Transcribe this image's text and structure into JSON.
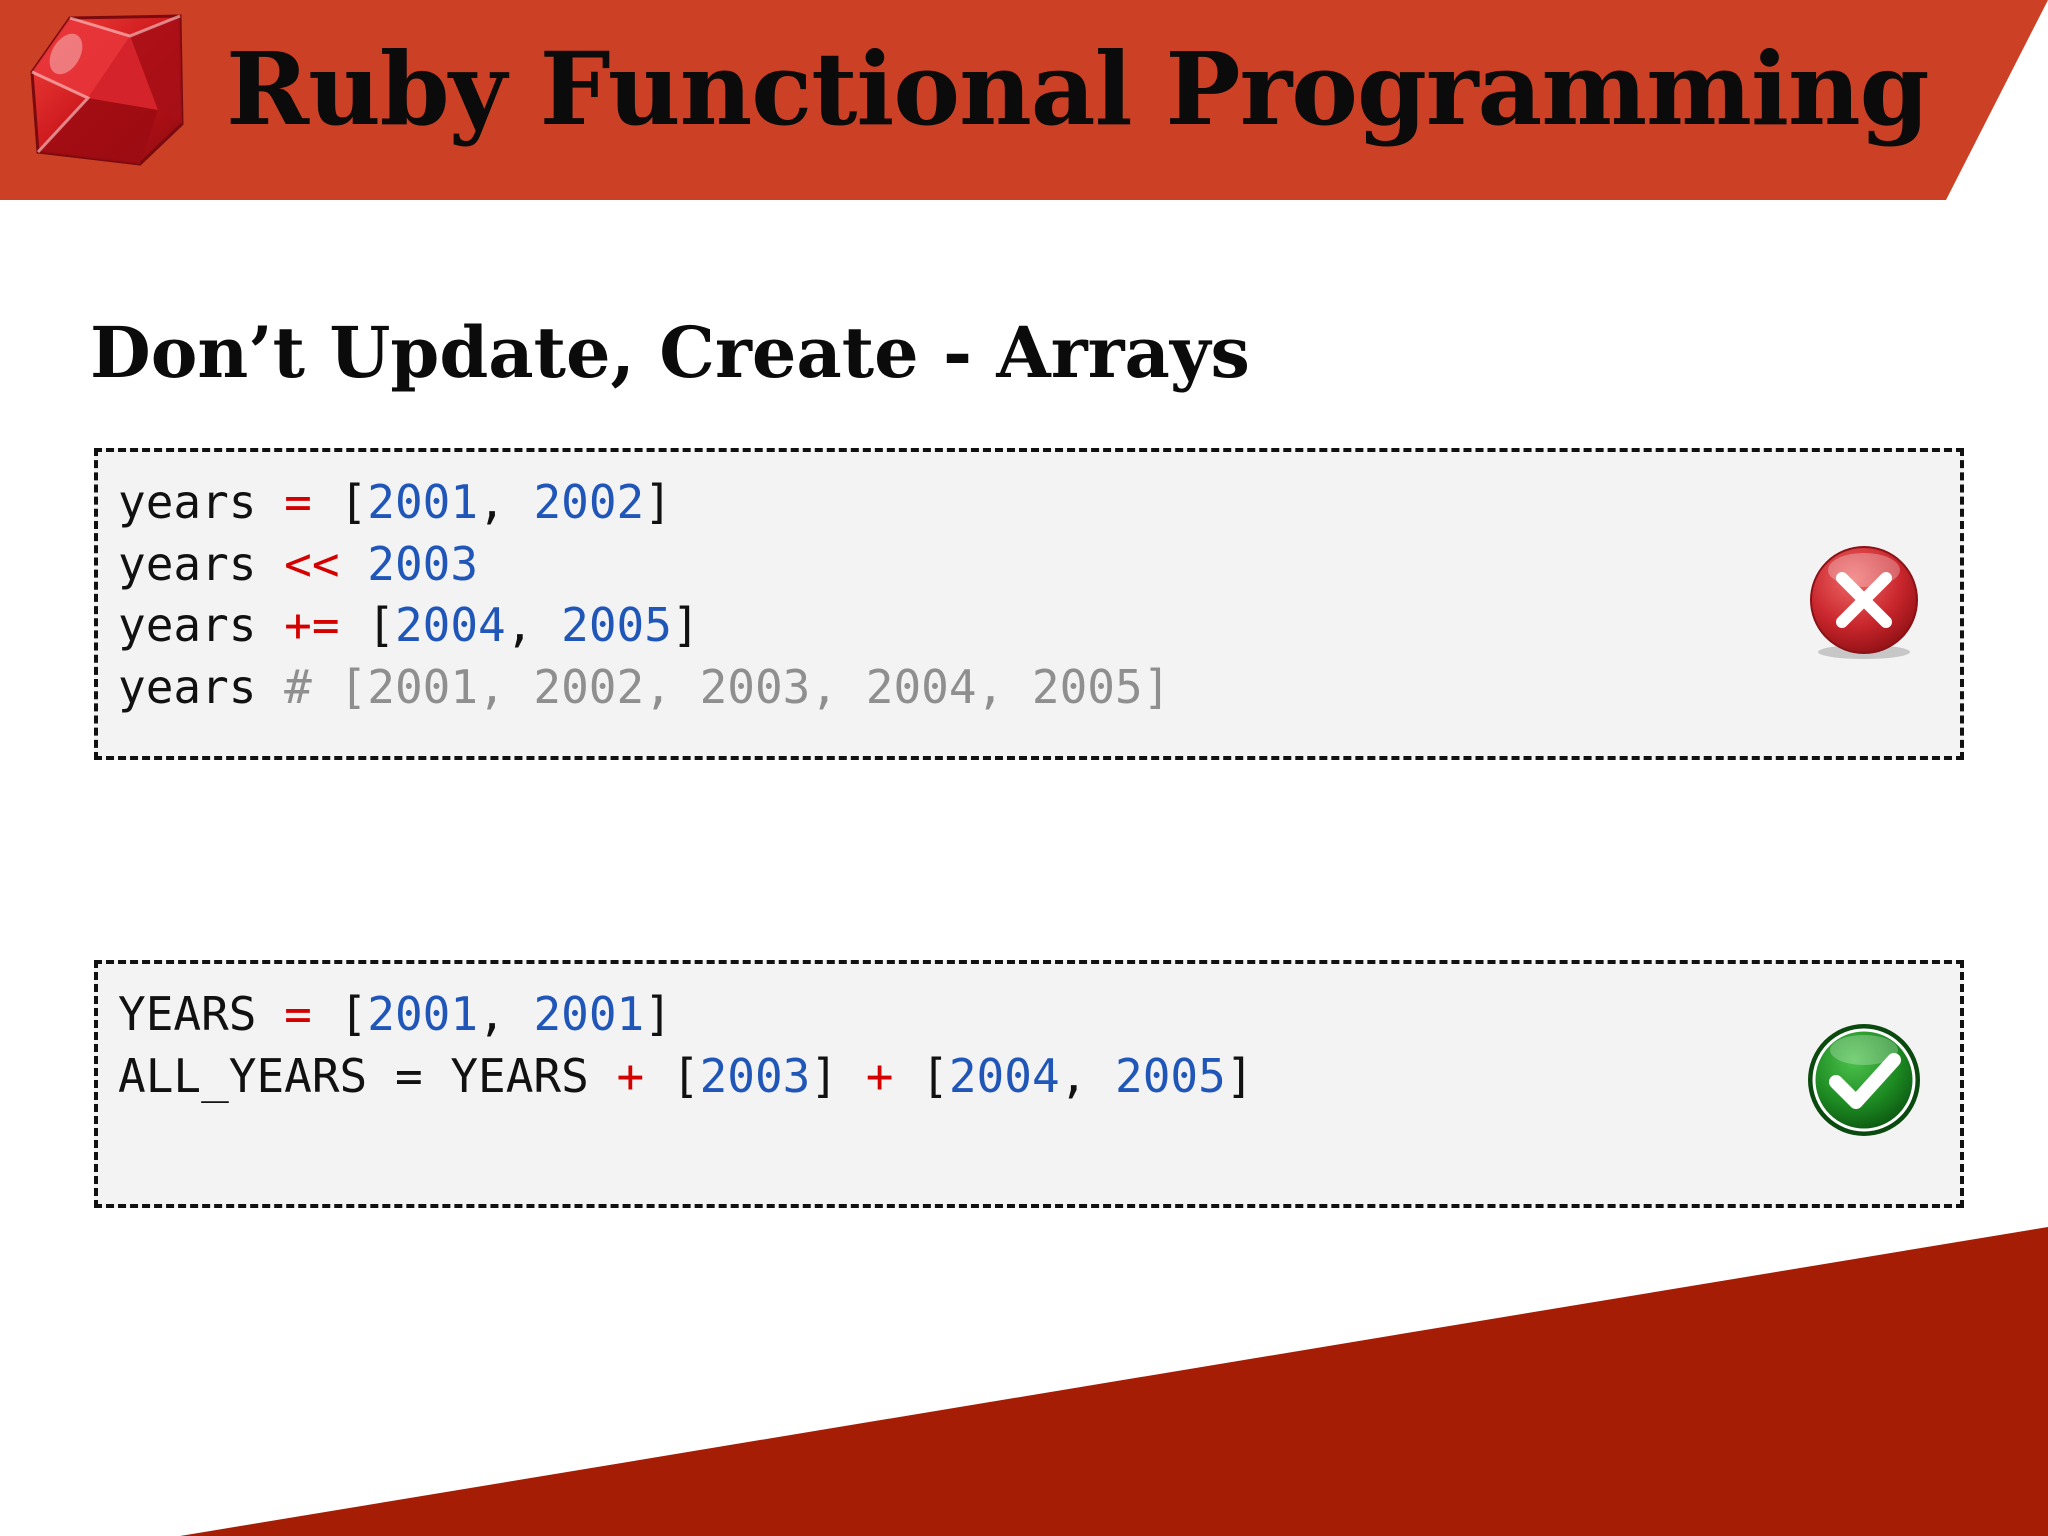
{
  "header": {
    "title": "Ruby Functional Programming",
    "logo_icon": "ruby-gem-icon"
  },
  "slide": {
    "heading": "Don’t Update, Create - Arrays"
  },
  "colors": {
    "header_band": "#cc4126",
    "footer_band": "#a51d05",
    "operator": "#d40000",
    "number": "#1f56b8",
    "comment": "#8f8f8f",
    "code_background": "#f3f3f4"
  },
  "bad_example": {
    "status_icon": "error-x-icon",
    "lines": [
      [
        {
          "t": "years ",
          "c": "plain"
        },
        {
          "t": "=",
          "c": "op"
        },
        {
          "t": " [",
          "c": "plain"
        },
        {
          "t": "2001",
          "c": "num"
        },
        {
          "t": ", ",
          "c": "plain"
        },
        {
          "t": "2002",
          "c": "num"
        },
        {
          "t": "]",
          "c": "plain"
        }
      ],
      [
        {
          "t": "years ",
          "c": "plain"
        },
        {
          "t": "<<",
          "c": "op"
        },
        {
          "t": " ",
          "c": "plain"
        },
        {
          "t": "2003",
          "c": "num"
        }
      ],
      [
        {
          "t": "years ",
          "c": "plain"
        },
        {
          "t": "+=",
          "c": "op"
        },
        {
          "t": " [",
          "c": "plain"
        },
        {
          "t": "2004",
          "c": "num"
        },
        {
          "t": ", ",
          "c": "plain"
        },
        {
          "t": "2005",
          "c": "num"
        },
        {
          "t": "]",
          "c": "plain"
        }
      ],
      [
        {
          "t": "years ",
          "c": "plain"
        },
        {
          "t": "# [2001, 2002, 2003, 2004, 2005]",
          "c": "comment"
        }
      ]
    ]
  },
  "good_example": {
    "status_icon": "success-check-icon",
    "lines": [
      [
        {
          "t": "YEARS ",
          "c": "plain"
        },
        {
          "t": "=",
          "c": "op"
        },
        {
          "t": " [",
          "c": "plain"
        },
        {
          "t": "2001",
          "c": "num"
        },
        {
          "t": ", ",
          "c": "plain"
        },
        {
          "t": "2001",
          "c": "num"
        },
        {
          "t": "]",
          "c": "plain"
        }
      ],
      [
        {
          "t": "ALL_YEARS = YEARS ",
          "c": "plain"
        },
        {
          "t": "+",
          "c": "op"
        },
        {
          "t": " [",
          "c": "plain"
        },
        {
          "t": "2003",
          "c": "num"
        },
        {
          "t": "] ",
          "c": "plain"
        },
        {
          "t": "+",
          "c": "op"
        },
        {
          "t": " [",
          "c": "plain"
        },
        {
          "t": "2004",
          "c": "num"
        },
        {
          "t": ", ",
          "c": "plain"
        },
        {
          "t": "2005",
          "c": "num"
        },
        {
          "t": "]",
          "c": "plain"
        }
      ]
    ]
  }
}
